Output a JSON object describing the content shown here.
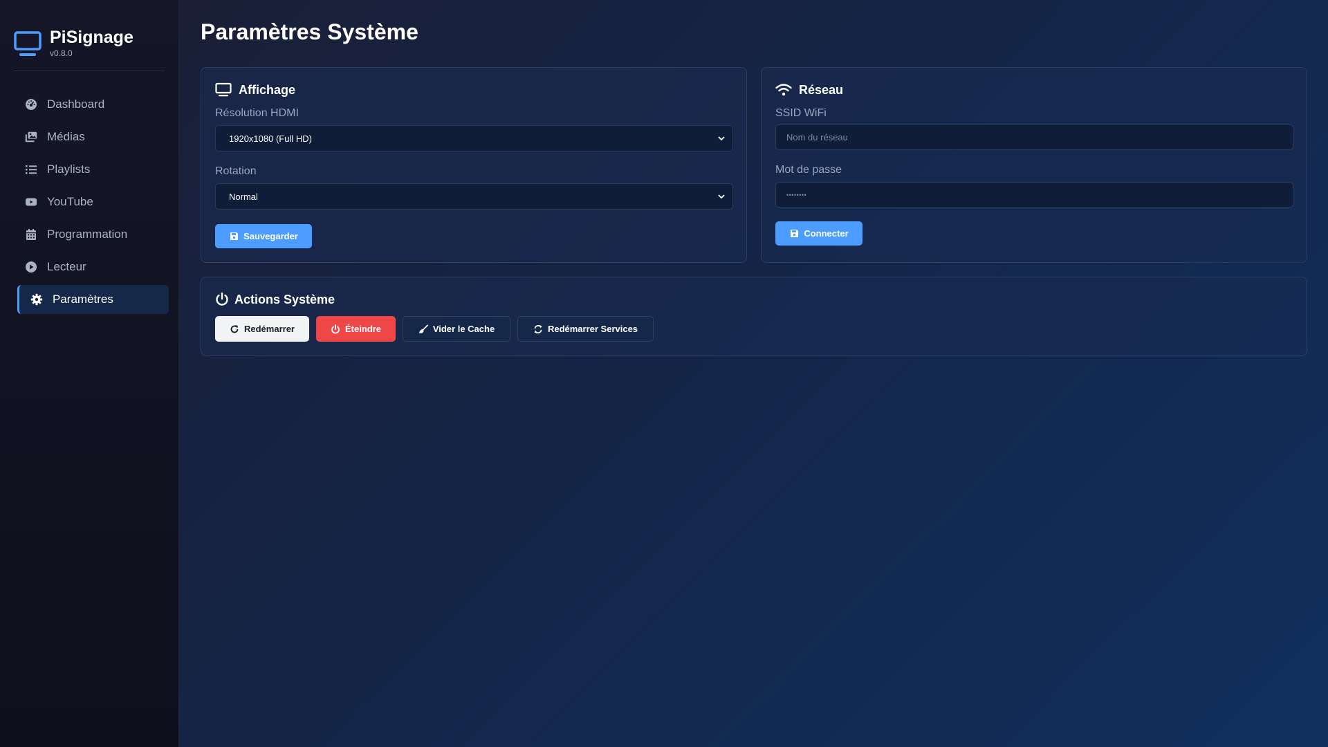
{
  "brand": {
    "name": "PiSignage",
    "version": "v0.8.0",
    "icon": "monitor-icon"
  },
  "sidebar": {
    "items": [
      {
        "label": "Dashboard",
        "icon": "dashboard-gauge-icon",
        "active": false
      },
      {
        "label": "Médias",
        "icon": "images-icon",
        "active": false
      },
      {
        "label": "Playlists",
        "icon": "list-icon",
        "active": false
      },
      {
        "label": "YouTube",
        "icon": "youtube-icon",
        "active": false
      },
      {
        "label": "Programmation",
        "icon": "calendar-icon",
        "active": false
      },
      {
        "label": "Lecteur",
        "icon": "play-circle-icon",
        "active": false
      },
      {
        "label": "Paramètres",
        "icon": "gear-icon",
        "active": true
      }
    ]
  },
  "page": {
    "title": "Paramètres Système"
  },
  "display_card": {
    "title": "Affichage",
    "resolution_label": "Résolution HDMI",
    "resolution_value": "1920x1080 (Full HD)",
    "rotation_label": "Rotation",
    "rotation_value": "Normal",
    "save_label": "Sauvegarder"
  },
  "network_card": {
    "title": "Réseau",
    "ssid_label": "SSID WiFi",
    "ssid_placeholder": "Nom du réseau",
    "password_label": "Mot de passe",
    "password_value": "••••••••",
    "connect_label": "Connecter"
  },
  "actions_card": {
    "title": "Actions Système",
    "restart_label": "Redémarrer",
    "shutdown_label": "Éteindre",
    "clear_cache_label": "Vider le Cache",
    "restart_services_label": "Redémarrer Services"
  },
  "colors": {
    "accent": "#4c9dff",
    "danger": "#ef4747",
    "sidebar_bg": "#0d0f1c",
    "active_nav_bg": "#16284a"
  }
}
